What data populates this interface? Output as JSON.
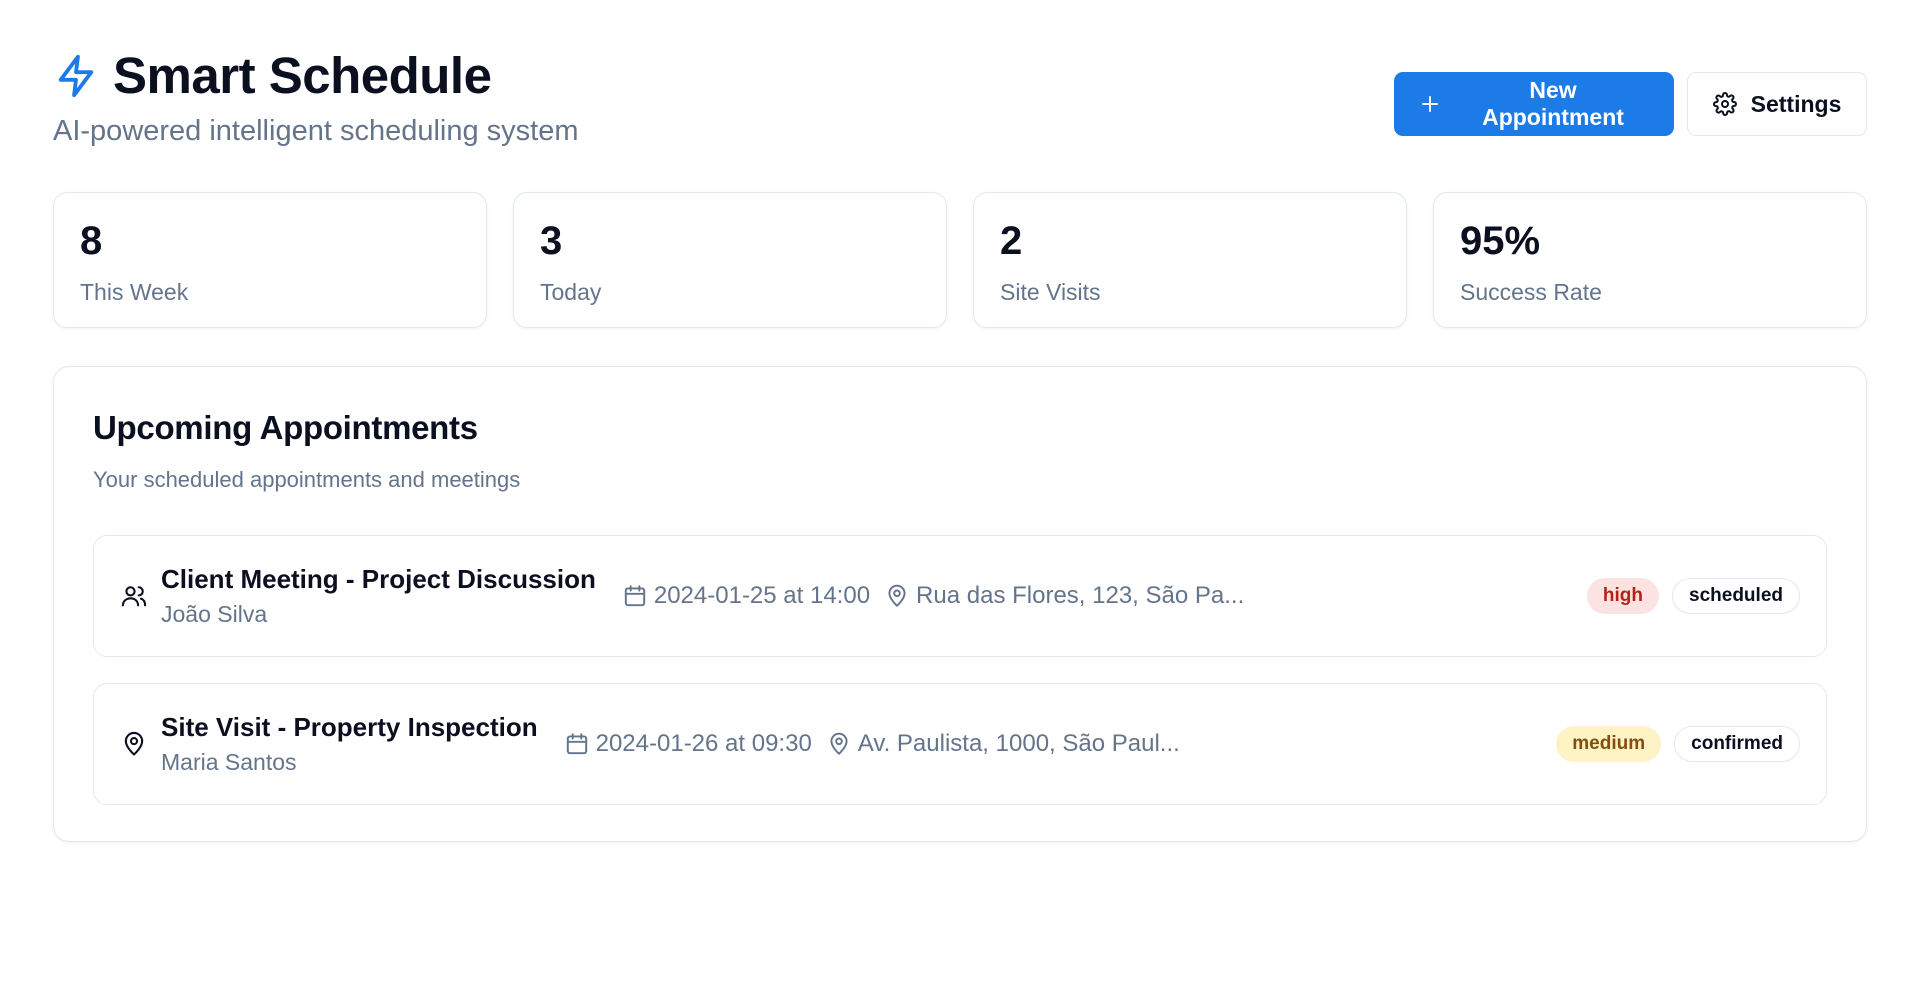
{
  "header": {
    "title": "Smart Schedule",
    "subtitle": "AI-powered intelligent scheduling system",
    "new_appointment_label": "New Appointment",
    "settings_label": "Settings"
  },
  "stats": [
    {
      "value": "8",
      "label": "This Week"
    },
    {
      "value": "3",
      "label": "Today"
    },
    {
      "value": "2",
      "label": "Site Visits"
    },
    {
      "value": "95%",
      "label": "Success Rate"
    }
  ],
  "upcoming": {
    "title": "Upcoming Appointments",
    "subtitle": "Your scheduled appointments and meetings",
    "items": [
      {
        "icon": "users-icon",
        "title": "Client Meeting - Project Discussion",
        "client": "João Silva",
        "datetime": "2024-01-25 at 14:00",
        "location": "Rua das Flores, 123, São Pa...",
        "priority": "high",
        "status": "scheduled"
      },
      {
        "icon": "map-pin-icon",
        "title": "Site Visit - Property Inspection",
        "client": "Maria Santos",
        "datetime": "2024-01-26 at 09:30",
        "location": "Av. Paulista, 1000, São Paul...",
        "priority": "medium",
        "status": "confirmed"
      }
    ]
  },
  "colors": {
    "accent": "#1d7be8",
    "high_bg": "#fde2e2",
    "high_text": "#b42318",
    "medium_bg": "#fdf3c4",
    "medium_text": "#854d0e"
  }
}
